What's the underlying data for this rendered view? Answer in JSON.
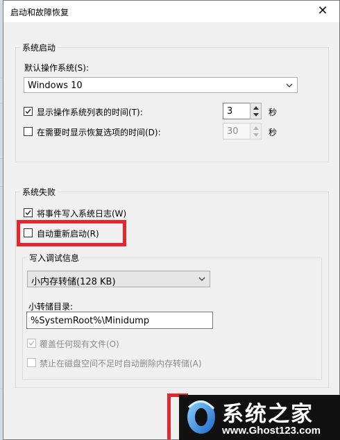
{
  "window": {
    "title": "启动和故障恢复",
    "close_glyph": "✕"
  },
  "system_startup": {
    "legend": "系统启动",
    "default_os_label": "默认操作系统(S):",
    "default_os_value": "Windows 10",
    "show_os_list": {
      "label": "显示操作系统列表的时间(T):",
      "checked": true,
      "value": "3",
      "unit": "秒"
    },
    "show_recovery": {
      "label": "在需要时显示恢复选项的时间(D):",
      "checked": false,
      "value": "30",
      "unit": "秒"
    }
  },
  "system_failure": {
    "legend": "系统失败",
    "write_event_log": {
      "label": "将事件写入系统日志(W)",
      "checked": true
    },
    "auto_restart": {
      "label": "自动重新启动(R)",
      "checked": false
    },
    "debug_info": {
      "legend": "写入调试信息",
      "dump_type": "小内存转储(128 KB)",
      "dump_dir_label": "小转储目录:",
      "dump_dir_value": "%SystemRoot%\\Minidump",
      "overwrite": {
        "label": "覆盖任何现有文件(O)",
        "checked": true
      },
      "disable_low_space": {
        "label": "禁止在磁盘空间不足时自动删除内存转储(A)",
        "checked": false
      }
    }
  },
  "watermark": {
    "title": "系统之家",
    "url": "www.Ghost123.com"
  },
  "colors": {
    "highlight": "#e4262f",
    "checkbox_enabled": "#333333",
    "checkbox_disabled": "#bcbcbc"
  }
}
